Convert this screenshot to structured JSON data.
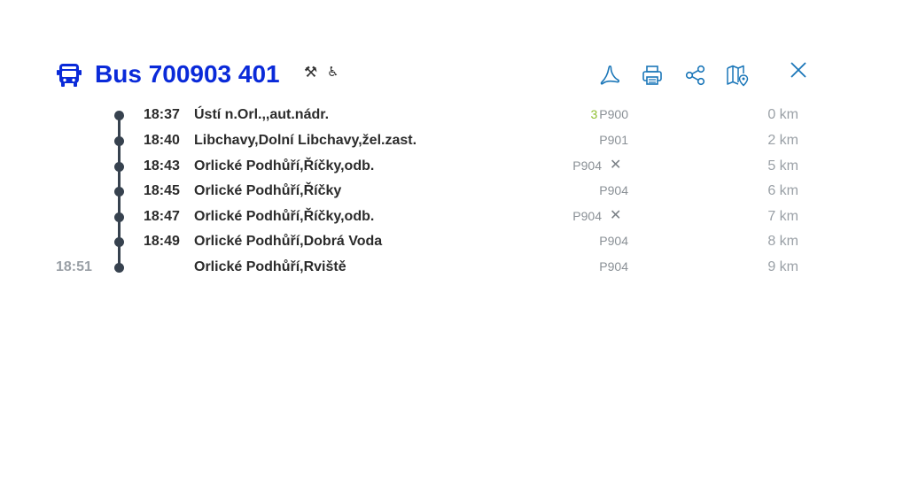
{
  "header": {
    "title": "Bus 700903 401",
    "accent_color": "#0a2ad9",
    "attribute_icons": [
      {
        "name": "hammer-pick-icon",
        "glyph": "⚒"
      },
      {
        "name": "wheelchair-icon",
        "glyph": "♿"
      }
    ],
    "tools": [
      {
        "name": "pdf-icon"
      },
      {
        "name": "print-icon"
      },
      {
        "name": "share-icon"
      },
      {
        "name": "map-icon"
      }
    ],
    "close_icon": "close-icon"
  },
  "stops": [
    {
      "dep": "18:37",
      "arr": "",
      "name": "Ústí n.Orl.,,aut.nádr.",
      "platform_num": "3",
      "platform": "P900",
      "request_stop": "",
      "distance": "0 km"
    },
    {
      "dep": "18:40",
      "arr": "",
      "name": "Libchavy,Dolní Libchavy,žel.zast.",
      "platform_num": "",
      "platform": "P901",
      "request_stop": "",
      "distance": "2 km"
    },
    {
      "dep": "18:43",
      "arr": "",
      "name": "Orlické Podhůří,Říčky,odb.",
      "platform_num": "",
      "platform": "P904",
      "request_stop": "✕",
      "distance": "5 km"
    },
    {
      "dep": "18:45",
      "arr": "",
      "name": "Orlické Podhůří,Říčky",
      "platform_num": "",
      "platform": "P904",
      "request_stop": "",
      "distance": "6 km"
    },
    {
      "dep": "18:47",
      "arr": "",
      "name": "Orlické Podhůří,Říčky,odb.",
      "platform_num": "",
      "platform": "P904",
      "request_stop": "✕",
      "distance": "7 km"
    },
    {
      "dep": "18:49",
      "arr": "",
      "name": "Orlické Podhůří,Dobrá Voda",
      "platform_num": "",
      "platform": "P904",
      "request_stop": "",
      "distance": "8 km"
    },
    {
      "dep": "",
      "arr": "18:51",
      "name": "Orlické Podhůří,Rviště",
      "platform_num": "",
      "platform": "P904",
      "request_stop": "",
      "distance": "9 km"
    }
  ]
}
